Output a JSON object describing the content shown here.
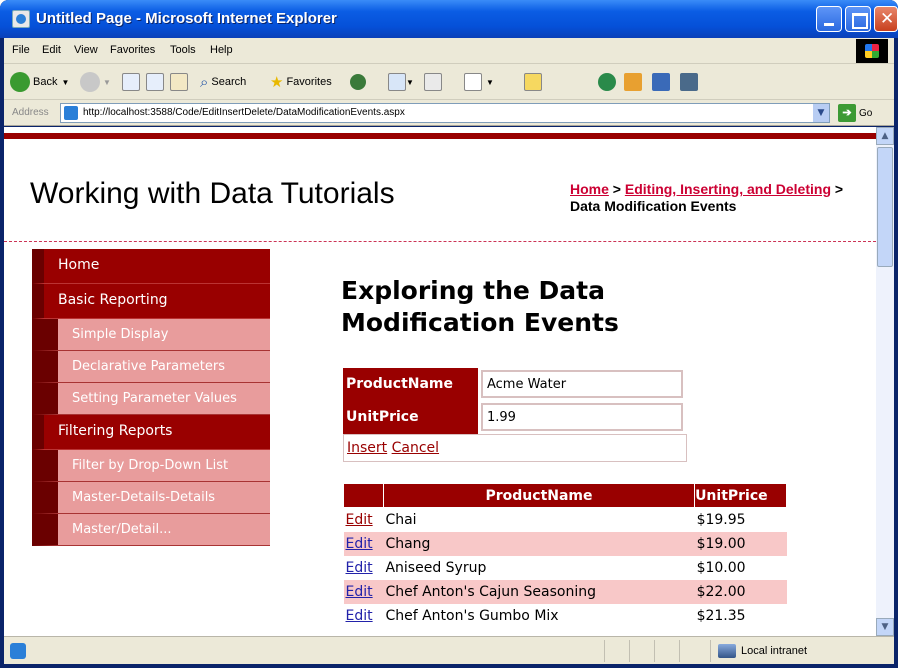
{
  "window": {
    "title": "Untitled Page - Microsoft Internet Explorer"
  },
  "menu": [
    "File",
    "Edit",
    "View",
    "Favorites",
    "Tools",
    "Help"
  ],
  "toolbar": {
    "back_label": "Back",
    "search_label": "Search",
    "favorites_label": "Favorites"
  },
  "address": {
    "label": "Address",
    "url": "http://localhost:3588/Code/EditInsertDelete/DataModificationEvents.aspx",
    "go_label": "Go"
  },
  "site": {
    "title": "Working with Data Tutorials"
  },
  "breadcrumb": {
    "home": "Home",
    "sep1": " > ",
    "parent": "Editing, Inserting, and Deleting",
    "sep2": " > ",
    "current": "Data Modification Events"
  },
  "nav": {
    "home": "Home",
    "basic_reporting": "Basic Reporting",
    "basic_items": [
      "Simple Display",
      "Declarative Parameters",
      "Setting Parameter Values"
    ],
    "filtering_reports": "Filtering Reports",
    "filtering_items": [
      "Filter by Drop-Down List",
      "Master-Details-Details",
      "Master/Detail..."
    ]
  },
  "main": {
    "heading": "Exploring the Data Modification Events"
  },
  "form": {
    "product_label": "ProductName",
    "product_value": "Acme Water",
    "price_label": "UnitPrice",
    "price_value": "1.99",
    "insert_label": "Insert",
    "cancel_label": "Cancel"
  },
  "grid": {
    "headers": [
      "",
      "ProductName",
      "UnitPrice"
    ],
    "edit_label": "Edit",
    "rows": [
      {
        "name": "Chai",
        "price": "$19.95"
      },
      {
        "name": "Chang",
        "price": "$19.00"
      },
      {
        "name": "Aniseed Syrup",
        "price": "$10.00"
      },
      {
        "name": "Chef Anton's Cajun Seasoning",
        "price": "$22.00"
      },
      {
        "name": "Chef Anton's Gumbo Mix",
        "price": "$21.35"
      }
    ]
  },
  "status": {
    "zone": "Local intranet"
  }
}
